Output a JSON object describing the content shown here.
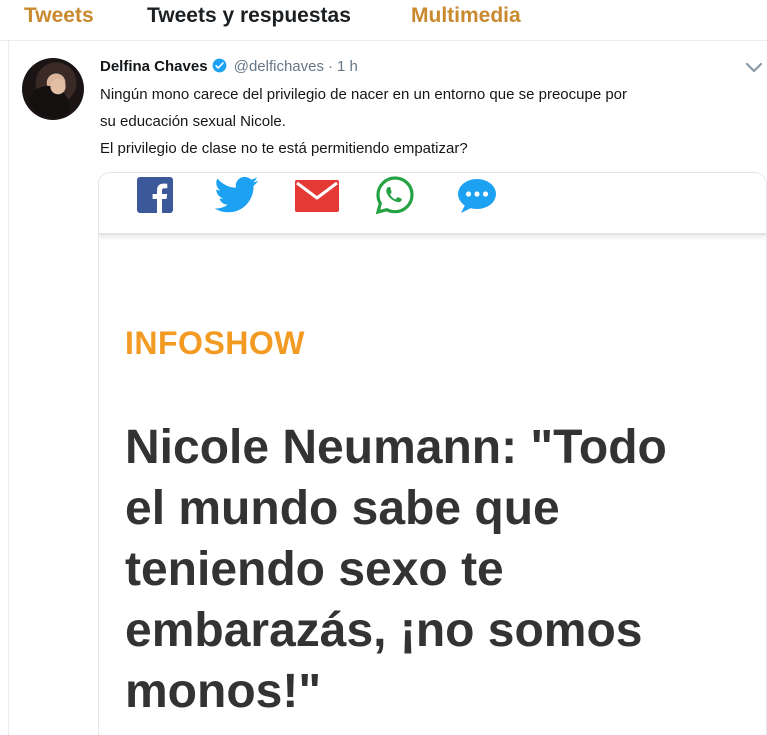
{
  "tabs": [
    {
      "label": "Tweets"
    },
    {
      "label": "Tweets y respuestas"
    },
    {
      "label": "Multimedia"
    }
  ],
  "tweet": {
    "author_name": "Delfina Chaves",
    "handle": "@delfichaves",
    "separator": "·",
    "time": "1 h",
    "text_lines": [
      "Ningún mono carece del privilegio de nacer en un entorno que se preocupe por",
      "su educación sexual Nicole.",
      "El privilegio de clase no te está permitiendo empatizar?"
    ]
  },
  "card": {
    "share_icons": [
      "facebook-icon",
      "twitter-icon",
      "email-icon",
      "whatsapp-icon",
      "message-icon"
    ],
    "kicker": "INFOSHOW",
    "headline_lines": [
      "Nicole Neumann: \"Todo",
      "el mundo sabe que",
      "teniendo sexo te",
      "embarazás, ¡no somos",
      "monos!\""
    ]
  },
  "colors": {
    "tab_accent": "#c9892e",
    "kicker": "#f39a22",
    "headline": "#333333",
    "facebook": "#3b5998",
    "twitter": "#1da1f2",
    "email": "#e53935",
    "whatsapp": "#25a244",
    "verified": "#1da1f2"
  }
}
